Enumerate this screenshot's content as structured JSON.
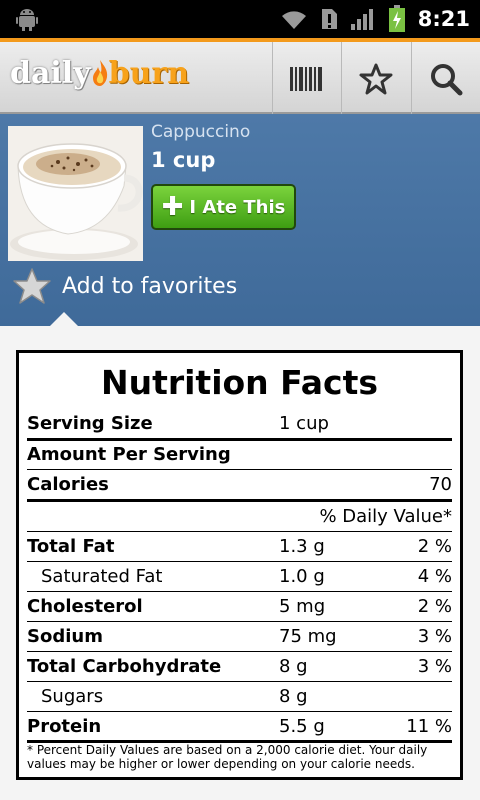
{
  "status_bar": {
    "time": "8:21",
    "icons": [
      "android-debug-icon",
      "wifi-icon",
      "alert-icon",
      "signal-icon",
      "battery-charging-icon"
    ]
  },
  "action_bar": {
    "logo_part1": "daily",
    "logo_part2": "burn",
    "buttons": [
      "barcode-icon",
      "star-icon",
      "search-icon"
    ]
  },
  "food": {
    "name": "Cappuccino",
    "serving": "1 cup",
    "ate_button": "I Ate This",
    "favorite_label": "Add to favorites"
  },
  "nutrition": {
    "title": "Nutrition Facts",
    "serving_size_label": "Serving Size",
    "serving_size_value": "1 cup",
    "amount_per_serving": "Amount Per Serving",
    "calories_label": "Calories",
    "calories_value": "70",
    "daily_value_header": "% Daily Value*",
    "rows": [
      {
        "label": "Total Fat",
        "amount": "1.3 g",
        "dv": "2 %"
      },
      {
        "label": "Saturated Fat",
        "amount": "1.0 g",
        "dv": "4 %"
      },
      {
        "label": "Cholesterol",
        "amount": "5 mg",
        "dv": "2 %"
      },
      {
        "label": "Sodium",
        "amount": "75 mg",
        "dv": "3 %"
      },
      {
        "label": "Total Carbohydrate",
        "amount": "8 g",
        "dv": "3 %"
      },
      {
        "label": "Sugars",
        "amount": "8 g",
        "dv": ""
      },
      {
        "label": "Protein",
        "amount": "5.5 g",
        "dv": "11 %"
      }
    ],
    "footnote": "* Percent Daily Values are based on a 2,000 calorie diet. Your daily values may be higher or lower depending on your calorie needs."
  },
  "colors": {
    "accent_orange": "#f39a1c",
    "header_blue": "#4a75a4",
    "button_green": "#5bb828"
  }
}
